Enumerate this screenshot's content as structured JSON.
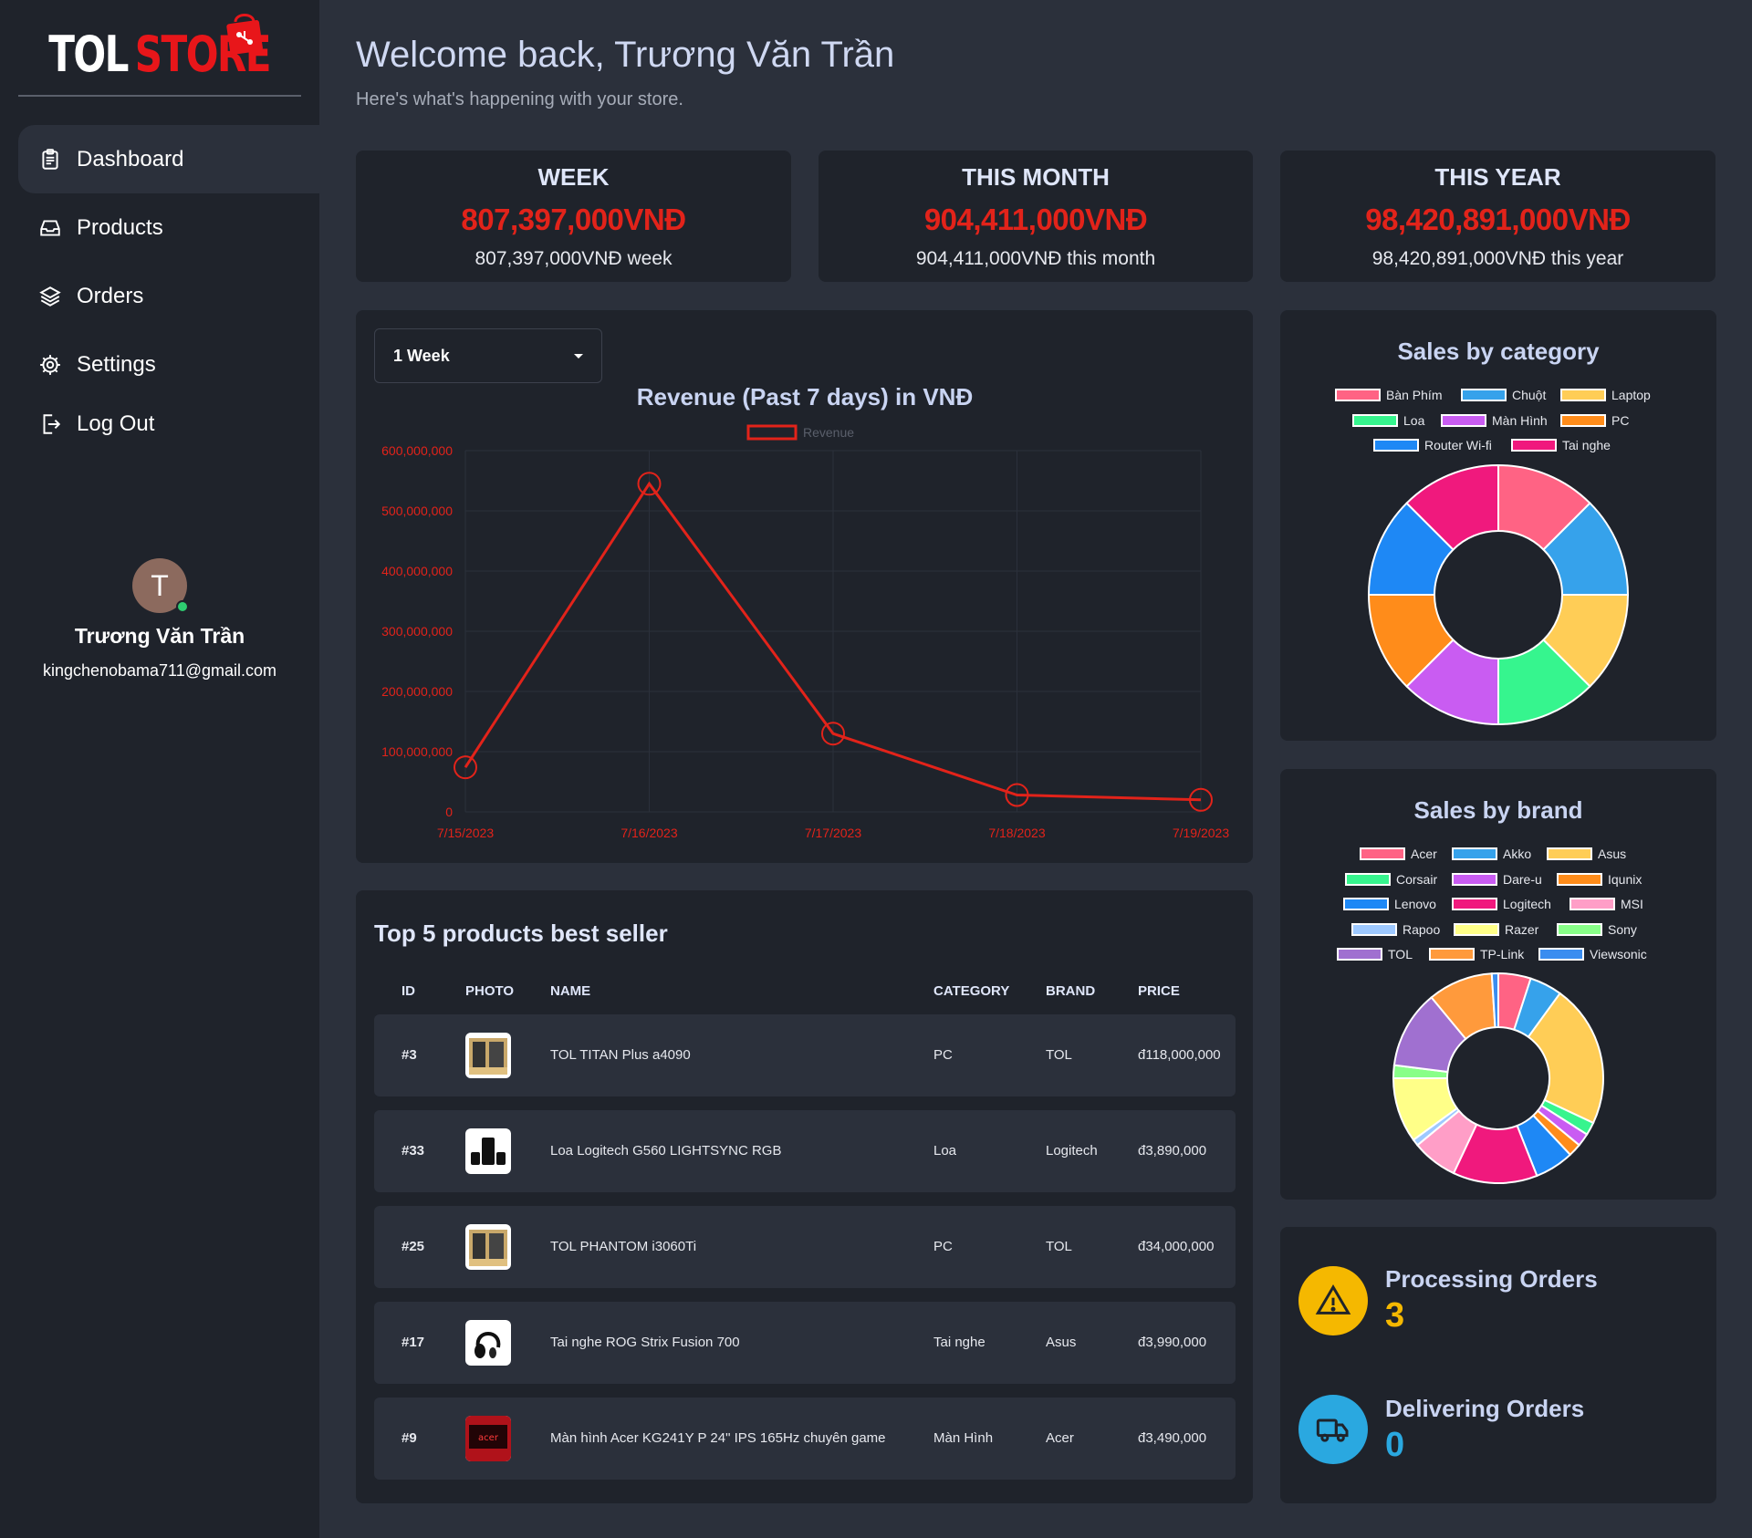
{
  "brand": {
    "part1": "TOL",
    "part2": "STORE"
  },
  "nav": [
    {
      "label": "Dashboard",
      "icon": "clipboard-icon",
      "active": true
    },
    {
      "label": "Products",
      "icon": "inbox-icon",
      "active": false
    },
    {
      "label": "Orders",
      "icon": "layers-icon",
      "active": false
    },
    {
      "label": "Settings",
      "icon": "gear-icon",
      "active": false
    },
    {
      "label": "Log Out",
      "icon": "logout-icon",
      "active": false
    }
  ],
  "profile": {
    "initial": "T",
    "name": "Trương Văn Trần",
    "email": "kingchenobama711@gmail.com",
    "status_color": "#2ecc71"
  },
  "header": {
    "title": "Welcome back, Trương Văn Trần",
    "subtitle": "Here's what's happening with your store."
  },
  "stats": [
    {
      "title": "WEEK",
      "value": "807,397,000VNĐ",
      "sub": "807,397,000VNĐ week"
    },
    {
      "title": "THIS MONTH",
      "value": "904,411,000VNĐ",
      "sub": "904,411,000VNĐ this month"
    },
    {
      "title": "THIS YEAR",
      "value": "98,420,891,000VNĐ",
      "sub": "98,420,891,000VNĐ this year"
    }
  ],
  "range_select": {
    "selected": "1 Week"
  },
  "chart_data": [
    {
      "type": "line",
      "title": "Revenue (Past 7 days) in VNĐ",
      "x": [
        "7/15/2023",
        "7/16/2023",
        "7/17/2023",
        "7/18/2023",
        "7/19/2023"
      ],
      "series": [
        {
          "name": "Revenue",
          "values": [
            74000000,
            545000000,
            130000000,
            28000000,
            20000000
          ],
          "color": "#e2231a"
        }
      ],
      "y_ticks": [
        "0",
        "100,000,000",
        "200,000,000",
        "300,000,000",
        "400,000,000",
        "500,000,000",
        "600,000,000"
      ],
      "ylim": [
        0,
        600000000
      ],
      "grid": true,
      "legend_position": "top"
    },
    {
      "type": "pie",
      "title": "Sales by category",
      "labels": [
        "Bàn Phím",
        "Chuột",
        "Laptop",
        "Loa",
        "Màn Hình",
        "PC",
        "Router Wi-fi",
        "Tai nghe"
      ],
      "values": [
        12.5,
        12.5,
        12.5,
        12.5,
        12.5,
        12.5,
        12.5,
        12.5
      ],
      "colors": [
        "#ff6384",
        "#36a2eb",
        "#ffcd56",
        "#36f58e",
        "#c95cf2",
        "#ff8c1a",
        "#1e88f5",
        "#f0197d"
      ],
      "legend_position": "top"
    },
    {
      "type": "pie",
      "title": "Sales by brand",
      "labels": [
        "Acer",
        "Akko",
        "Asus",
        "Corsair",
        "Dare-u",
        "Iqunix",
        "Lenovo",
        "Logitech",
        "MSI",
        "Rapoo",
        "Razer",
        "Sony",
        "TOL",
        "TP-Link",
        "Viewsonic"
      ],
      "values": [
        5,
        5,
        22,
        2,
        2,
        2,
        6,
        13,
        7,
        1,
        10,
        2,
        12,
        10,
        1
      ],
      "colors": [
        "#ff6384",
        "#36a2eb",
        "#ffcd56",
        "#36f58e",
        "#c95cf2",
        "#ff8c1a",
        "#1e88f5",
        "#f0197d",
        "#ff9ec7",
        "#9ec9ff",
        "#ffff88",
        "#88ff88",
        "#a070d0",
        "#ff9a3c",
        "#3a8df0"
      ],
      "legend_position": "top"
    }
  ],
  "top_products": {
    "title": "Top 5 products best seller",
    "columns": [
      "ID",
      "PHOTO",
      "NAME",
      "CATEGORY",
      "BRAND",
      "PRICE"
    ],
    "rows": [
      {
        "id": "#3",
        "name": "TOL TITAN Plus a4090",
        "category": "PC",
        "brand": "TOL",
        "price": "đ118,000,000",
        "photo": "pc-case-image"
      },
      {
        "id": "#33",
        "name": "Loa Logitech G560 LIGHTSYNC RGB",
        "category": "Loa",
        "brand": "Logitech",
        "price": "đ3,890,000",
        "photo": "speaker-image"
      },
      {
        "id": "#25",
        "name": "TOL PHANTOM i3060Ti",
        "category": "PC",
        "brand": "TOL",
        "price": "đ34,000,000",
        "photo": "pc-case-image"
      },
      {
        "id": "#17",
        "name": "Tai nghe ROG Strix Fusion 700",
        "category": "Tai nghe",
        "brand": "Asus",
        "price": "đ3,990,000",
        "photo": "headset-image"
      },
      {
        "id": "#9",
        "name": "Màn hình Acer KG241Y P 24\" IPS 165Hz chuyên game",
        "category": "Màn Hình",
        "brand": "Acer",
        "price": "đ3,490,000",
        "photo": "monitor-image"
      }
    ]
  },
  "orders": {
    "processing": {
      "label": "Processing Orders",
      "value": "3",
      "color": "#f5b800",
      "icon": "warning-icon"
    },
    "delivering": {
      "label": "Delivering Orders",
      "value": "0",
      "color": "#2aa8e0",
      "icon": "truck-icon"
    }
  }
}
